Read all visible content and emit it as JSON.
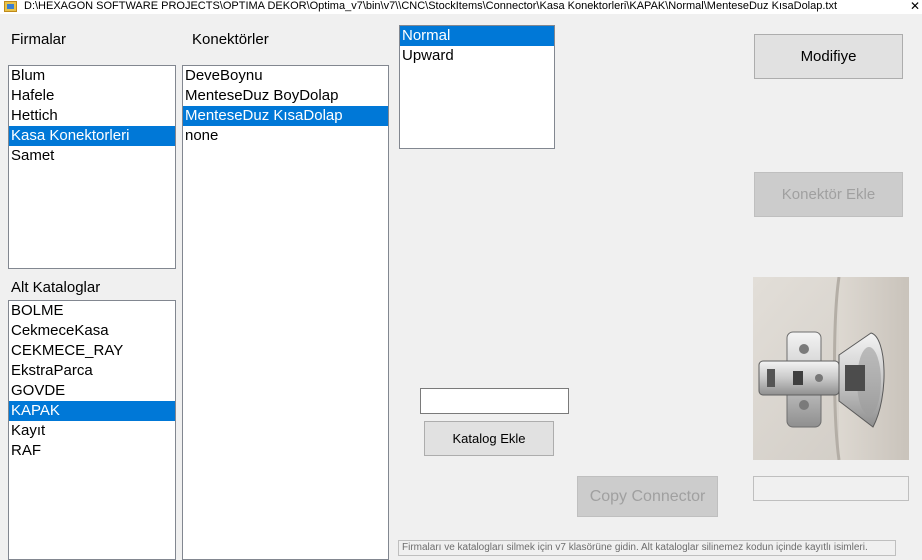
{
  "window": {
    "title": "D:\\HEXAGON SOFTWARE PROJECTS\\OPTIMA DEKOR\\Optima_v7\\bin\\v7\\\\CNC\\StockItems\\Connector\\Kasa Konektorleri\\KAPAK\\Normal\\MenteseDuz KısaDolap.txt",
    "close_glyph": "✕"
  },
  "firmalar": {
    "label": "Firmalar",
    "items": [
      "Blum",
      "Hafele",
      "Hettich",
      "Kasa Konektorleri",
      "Samet"
    ],
    "selected": "Kasa Konektorleri"
  },
  "konektorler": {
    "label": "Konektörler",
    "items": [
      "DeveBoynu",
      "MenteseDuz BoyDolap",
      "MenteseDuz KısaDolap",
      "none"
    ],
    "selected": "MenteseDuz KısaDolap"
  },
  "direction": {
    "items": [
      "Normal",
      "Upward"
    ],
    "selected": "Normal"
  },
  "alt_kataloglar": {
    "label": "Alt Kataloglar",
    "items": [
      "BOLME",
      "CekmeceKasa",
      "CEKMECE_RAY",
      "EkstraParca",
      "GOVDE",
      "KAPAK",
      "Kayıt",
      "RAF"
    ],
    "selected": "KAPAK"
  },
  "buttons": {
    "modifiye": "Modifiye",
    "konektor_ekle": "Konektör Ekle",
    "katalog_ekle": "Katalog Ekle",
    "copy_connector": "Copy Connector"
  },
  "inputs": {
    "katalog_name": "",
    "image_path": ""
  },
  "footer": {
    "note": "Firmaları ve katalogları silmek için v7 klasörüne gidin. Alt kataloglar silinemez kodun içinde kayıtlı isimleri."
  },
  "image": {
    "subject": "hinge-photo"
  }
}
